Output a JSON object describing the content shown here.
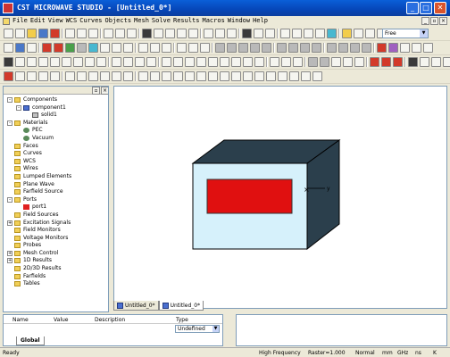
{
  "window": {
    "title": "CST MICROWAVE STUDIO - [Untitled_0*]"
  },
  "menu": {
    "items": [
      "File",
      "Edit",
      "View",
      "WCS",
      "Curves",
      "Objects",
      "Mesh",
      "Solve",
      "Results",
      "Macros",
      "Window",
      "Help"
    ]
  },
  "toolbar": {
    "view_mode": "Free"
  },
  "tree": {
    "items": [
      {
        "label": "Components",
        "level": 0,
        "icon": "folder",
        "expand": "-"
      },
      {
        "label": "component1",
        "level": 1,
        "icon": "component",
        "expand": "-"
      },
      {
        "label": "solid1",
        "level": 2,
        "icon": "solid",
        "expand": ""
      },
      {
        "label": "Materials",
        "level": 0,
        "icon": "folder",
        "expand": "-"
      },
      {
        "label": "PEC",
        "level": 1,
        "icon": "material",
        "expand": ""
      },
      {
        "label": "Vacuum",
        "level": 1,
        "icon": "material",
        "expand": ""
      },
      {
        "label": "Faces",
        "level": 0,
        "icon": "folder",
        "expand": ""
      },
      {
        "label": "Curves",
        "level": 0,
        "icon": "folder",
        "expand": ""
      },
      {
        "label": "WCS",
        "level": 0,
        "icon": "folder",
        "expand": ""
      },
      {
        "label": "Wires",
        "level": 0,
        "icon": "folder",
        "expand": ""
      },
      {
        "label": "Lumped Elements",
        "level": 0,
        "icon": "folder",
        "expand": ""
      },
      {
        "label": "Plane Wave",
        "level": 0,
        "icon": "folder",
        "expand": ""
      },
      {
        "label": "Farfield Source",
        "level": 0,
        "icon": "folder",
        "expand": ""
      },
      {
        "label": "Ports",
        "level": 0,
        "icon": "folder",
        "expand": "-"
      },
      {
        "label": "port1",
        "level": 1,
        "icon": "port",
        "expand": ""
      },
      {
        "label": "Field Sources",
        "level": 0,
        "icon": "folder",
        "expand": ""
      },
      {
        "label": "Excitation Signals",
        "level": 0,
        "icon": "folder",
        "expand": "+"
      },
      {
        "label": "Field Monitors",
        "level": 0,
        "icon": "folder",
        "expand": ""
      },
      {
        "label": "Voltage Monitors",
        "level": 0,
        "icon": "folder",
        "expand": ""
      },
      {
        "label": "Probes",
        "level": 0,
        "icon": "folder",
        "expand": ""
      },
      {
        "label": "Mesh Control",
        "level": 0,
        "icon": "folder",
        "expand": "+"
      },
      {
        "label": "1D Results",
        "level": 0,
        "icon": "folder",
        "expand": "+"
      },
      {
        "label": "2D/3D Results",
        "level": 0,
        "icon": "folder",
        "expand": ""
      },
      {
        "label": "Farfields",
        "level": 0,
        "icon": "folder",
        "expand": ""
      },
      {
        "label": "Tables",
        "level": 0,
        "icon": "folder",
        "expand": ""
      }
    ]
  },
  "viewport": {
    "axis_x": "x",
    "axis_y": "y",
    "colors": {
      "box_face": "#2b3f4c",
      "front_face": "#d6f1fb",
      "port": "#e01010"
    }
  },
  "doc_tabs": [
    "Untitled_0*",
    "Untitled_0*"
  ],
  "params": {
    "headers": [
      "Name",
      "Value",
      "Description",
      "Type"
    ],
    "type_value": "Undefined",
    "tab": "Global"
  },
  "status": {
    "ready": "Ready",
    "solver": "High Frequency",
    "raster": "Raster=1.000",
    "mode": "Normal",
    "units": [
      "mm",
      "GHz",
      "ns",
      "K"
    ]
  }
}
